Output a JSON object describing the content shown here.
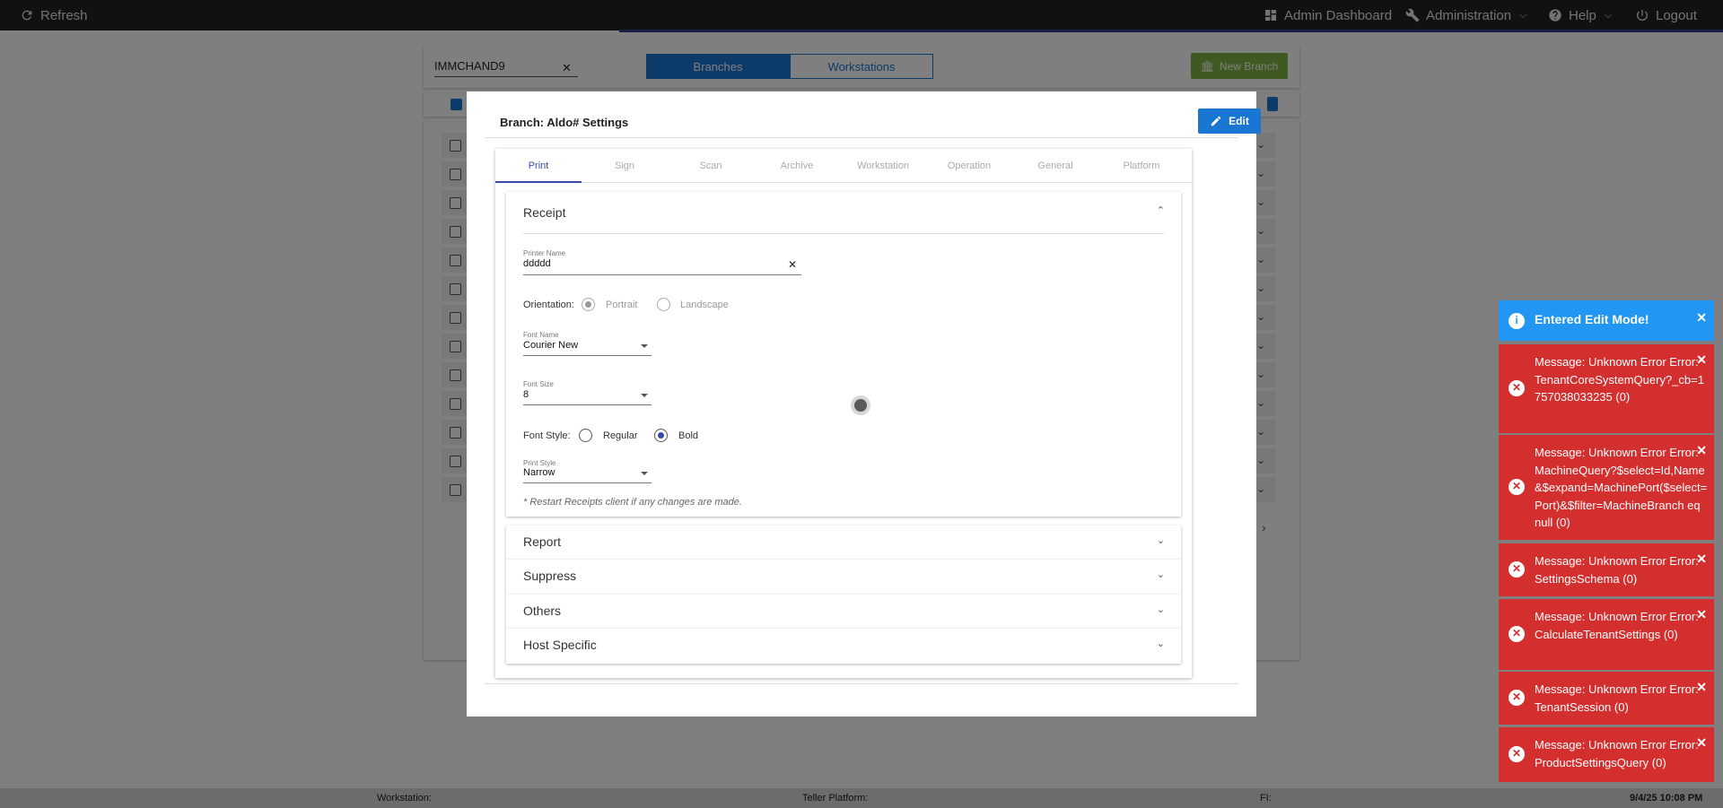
{
  "topbar": {
    "refresh": "Refresh",
    "admin_dashboard": "Admin Dashboard",
    "administration": "Administration",
    "help": "Help",
    "logout": "Logout"
  },
  "branches_page": {
    "search_value": "IMMCHAND9",
    "toggle_branches": "Branches",
    "toggle_workstations": "Workstations",
    "new_branch": "New Branch"
  },
  "modal": {
    "title": "Branch: Aldo# Settings",
    "edit_label": "Edit",
    "tabs": [
      "Print",
      "Sign",
      "Scan",
      "Archive",
      "Workstation",
      "Operation",
      "General",
      "Platform"
    ],
    "receipt": {
      "title": "Receipt",
      "printer_name_label": "Printer Name",
      "printer_name_value": "ddddd",
      "orientation_label": "Orientation:",
      "orientation_portrait": "Portrait",
      "orientation_landscape": "Landscape",
      "font_name_label": "Font Name",
      "font_name_value": "Courier New",
      "font_size_label": "Font Size",
      "font_size_value": "8",
      "font_style_label": "Font Style:",
      "font_style_regular": "Regular",
      "font_style_bold": "Bold",
      "print_style_label": "Print Style",
      "print_style_value": "Narrow",
      "note": "* Restart Receipts client if any changes are made."
    },
    "sections": [
      "Report",
      "Suppress",
      "Others",
      "Host Specific"
    ]
  },
  "toasts": [
    {
      "type": "info",
      "text": "Entered Edit Mode!"
    },
    {
      "type": "error",
      "text": "Message: Unknown Error Error: TenantCoreSystemQuery?_cb=1757038033235 (0)"
    },
    {
      "type": "error",
      "text": "Message: Unknown Error Error: MachineQuery?$select=Id,Name&$expand=MachinePort($select=Port)&$filter=MachineBranch eq null (0)"
    },
    {
      "type": "error",
      "text": "Message: Unknown Error Error: SettingsSchema (0)"
    },
    {
      "type": "error",
      "text": "Message: Unknown Error Error: CalculateTenantSettings (0)"
    },
    {
      "type": "error",
      "text": "Message: Unknown Error Error: TenantSession (0)"
    },
    {
      "type": "error",
      "text": "Message: Unknown Error Error: ProductSettingsQuery (0)"
    }
  ],
  "statusbar": {
    "workstation": "Workstation:",
    "teller_platform": "Teller Platform:",
    "fi": "FI:",
    "datetime": "9/4/25 10:08 PM"
  },
  "colors": {
    "primary": "#1976d2",
    "new_branch": "#7cb342",
    "error": "#d32f2f",
    "info": "#2196f3",
    "topbar": "#222222"
  }
}
